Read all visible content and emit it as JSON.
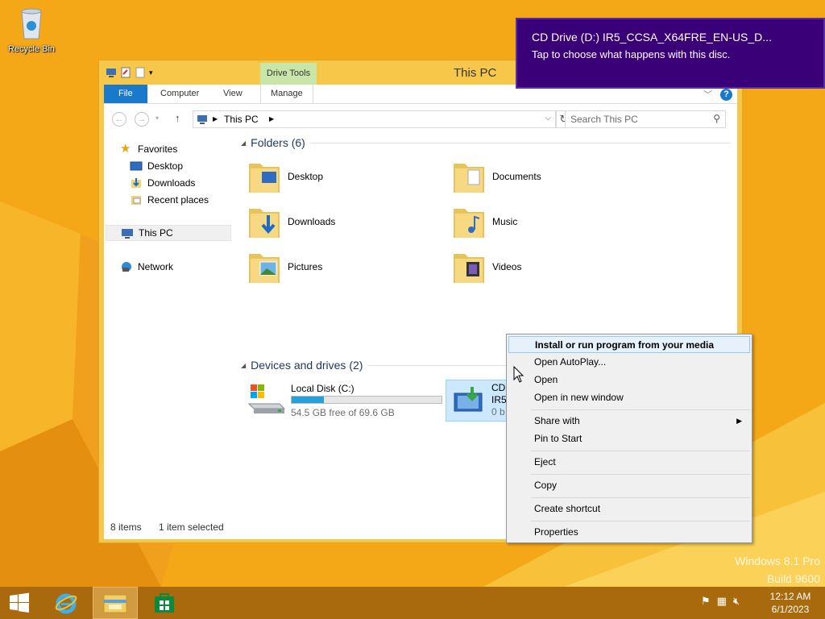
{
  "desktop": {
    "recycle_bin_label": "Recycle Bin"
  },
  "window": {
    "title": "This PC",
    "contextual_tab_group": "Drive Tools",
    "tabs": {
      "file": "File",
      "computer": "Computer",
      "view": "View",
      "manage": "Manage"
    },
    "address": {
      "path": "This PC"
    },
    "search": {
      "placeholder": "Search This PC"
    }
  },
  "navpane": {
    "favorites": "Favorites",
    "desktop": "Desktop",
    "downloads": "Downloads",
    "recent_places": "Recent places",
    "this_pc": "This PC",
    "network": "Network"
  },
  "folders": {
    "header": "Folders (6)",
    "items": [
      "Desktop",
      "Documents",
      "Downloads",
      "Music",
      "Pictures",
      "Videos"
    ]
  },
  "devices": {
    "header": "Devices and drives (2)",
    "local_disk": {
      "name": "Local Disk (C:)",
      "free_text": "54.5 GB free of 69.6 GB",
      "used_fraction": 0.217
    },
    "cd_drive": {
      "name": "CD Drive (D:)",
      "line2": "IR5",
      "line3": "0 b"
    }
  },
  "status": {
    "items_count": "8 items",
    "selected": "1 item selected"
  },
  "context_menu": {
    "install": "Install or run program from your media",
    "open_autoplay": "Open AutoPlay...",
    "open": "Open",
    "open_new_window": "Open in new window",
    "share_with": "Share with",
    "pin_to_start": "Pin to Start",
    "eject": "Eject",
    "copy": "Copy",
    "create_shortcut": "Create shortcut",
    "properties": "Properties"
  },
  "toast": {
    "title": "CD Drive (D:) IR5_CCSA_X64FRE_EN-US_D...",
    "message": "Tap to choose what happens with this disc."
  },
  "watermark": {
    "line1": "Windows 8.1 Pro",
    "line2": "Build 9600"
  },
  "taskbar": {
    "time": "12:12 AM",
    "date": "6/1/2023"
  },
  "colors": {
    "desktop": "#f4a818",
    "file_tab": "#1979ca",
    "toast_bg": "#3a0078",
    "taskbar": "#a86a0c",
    "drive_bar": "#26a0da"
  }
}
